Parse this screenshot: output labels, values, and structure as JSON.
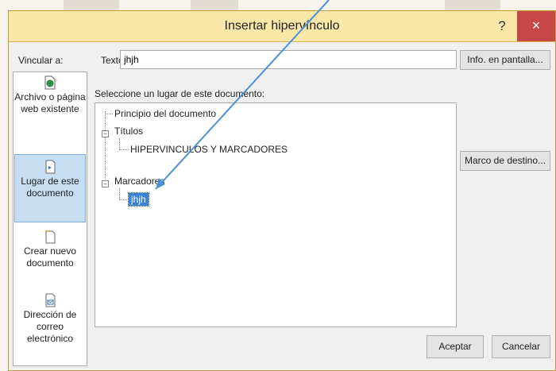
{
  "dialog": {
    "title": "Insertar hipervínculo",
    "help": "?",
    "close": "×"
  },
  "link_to": {
    "label": "Vincular a:",
    "items": [
      {
        "label": "Archivo o página web existente",
        "selected": false
      },
      {
        "label": "Lugar de este documento",
        "selected": true
      },
      {
        "label": "Crear nuevo documento",
        "selected": false
      },
      {
        "label": "Dirección de correo electrónico",
        "selected": false
      }
    ]
  },
  "text_field": {
    "label": "Texto:",
    "value": "jhjh"
  },
  "screentip_button": "Info. en pantalla...",
  "select_label": "Seleccione un lugar de este documento:",
  "tree": {
    "top": "Principio del documento",
    "headings_label": "Títulos",
    "headings_item": "HIPERVINCULOS Y MARCADORES",
    "bookmarks_label": "Marcadores",
    "bookmarks_item": "jhjh"
  },
  "target_frame_button": "Marco de destino...",
  "ok_button": "Aceptar",
  "cancel_button": "Cancelar",
  "colors": {
    "titlebar": "#fbe7a8",
    "close": "#c74748",
    "selection": "#3b82d9",
    "arrow": "#4a90d9"
  }
}
